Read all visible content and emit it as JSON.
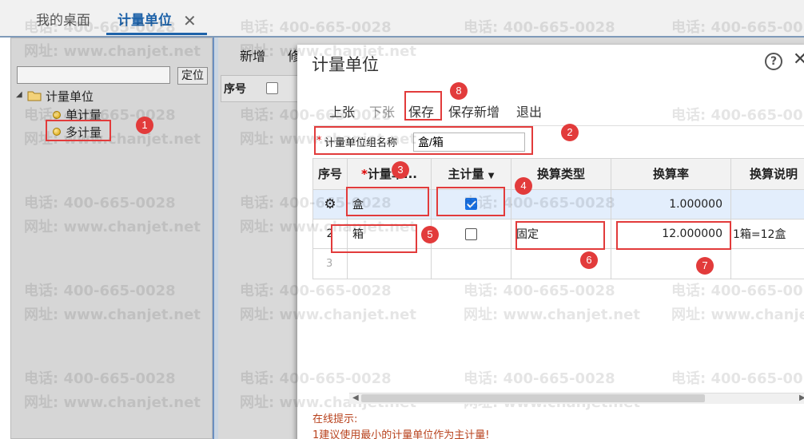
{
  "tabs": {
    "desktop": "我的桌面",
    "unit": "计量单位"
  },
  "left_panel": {
    "locate_button": "定位",
    "tree_root": "计量单位",
    "items": [
      "单计量",
      "多计量"
    ]
  },
  "main_toolbar": {
    "add": "新增",
    "edit": "修"
  },
  "main_grid": {
    "seq": "序号"
  },
  "dialog": {
    "title": "计量单位",
    "toolbar": {
      "prev": "上张",
      "next": "下张",
      "save": "保存",
      "save_new": "保存新增",
      "exit": "退出"
    },
    "group_label": "计量单位组名称",
    "group_value": "盒/箱",
    "columns": {
      "seq": "序号",
      "unit": "计量单...",
      "main": "主计量",
      "type": "换算类型",
      "rate": "换算率",
      "desc": "换算说明"
    },
    "rows": [
      {
        "unit": "盒",
        "main": true,
        "type": "",
        "rate": "1.000000",
        "desc": ""
      },
      {
        "seq": "2",
        "unit": "箱",
        "main": false,
        "type": "固定",
        "rate": "12.000000",
        "desc": "1箱=12盒"
      },
      {
        "seq": "3"
      }
    ],
    "hint_title": "在线提示:",
    "hint_text": "1建议使用最小的计量单位作为主计量!"
  },
  "watermark": {
    "phone": "电话: 400-665-0028",
    "site": "网址: www.chanjet.net"
  },
  "annotations": [
    "1",
    "2",
    "3",
    "4",
    "5",
    "6",
    "7",
    "8"
  ]
}
